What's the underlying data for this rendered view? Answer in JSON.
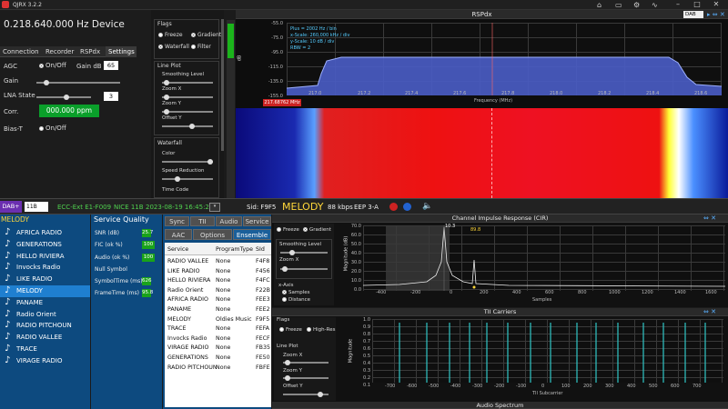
{
  "app": {
    "title": "QJRX 3.2.2",
    "window_controls": [
      "minimize-icon",
      "maximize-icon",
      "close-icon"
    ]
  },
  "frequency": {
    "display": "0.218.640.000 Hz Device"
  },
  "device_tabs": [
    "Connection",
    "Recorder",
    "RSPdx",
    "Settings"
  ],
  "device_settings": {
    "agc_label": "AGC",
    "agc_checkbox_label": "On/Off",
    "gain_db_label": "Gain dB",
    "gain_db_value": "65",
    "gain_label": "Gain",
    "lna_label": "LNA State",
    "lna_value": "3",
    "corr_label": "Corr.",
    "corr_value": "000.000 ppm",
    "biast_label": "Bias-T",
    "biast_radio_label": "On/Off"
  },
  "spectrum_settings": {
    "flags_title": "Flags",
    "freeze": "Freeze",
    "gradient": "Gradient",
    "waterfall": "Waterfall",
    "filter": "Filter",
    "line_plot_title": "Line Plot",
    "smoothing": "Smoothing Level",
    "zoom_x": "Zoom X",
    "zoom_y": "Zoom Y",
    "offset_y": "Offset Y",
    "waterfall_title": "Waterfall",
    "color": "Color",
    "speed": "Speed Reduction",
    "time_code": "Time Code"
  },
  "rspdx": {
    "title": "RSPdx",
    "mode": "DAB",
    "info_lines": [
      "Plus = 2002 Hz / bin",
      "x-Scale: 260,000 kHz / div",
      "y-Scale: 10 dB / div",
      "RBW = 2"
    ],
    "ylabel": "dB",
    "y_ticks": [
      "-55.0",
      "-75.0",
      "-95.0",
      "-115.0",
      "-135.0",
      "-155.0"
    ],
    "x_ticks": [
      "217.0",
      "217.2",
      "217.4",
      "217.6",
      "217.8",
      "218.0",
      "218.2",
      "218.4",
      "218.6"
    ],
    "xlabel": "Frequency (MHz)",
    "marker": "217.68762 MHz"
  },
  "status_bar": {
    "mode": "DAB+",
    "channel": "11B",
    "ensemble_info": "ECC-Ext E1-F009",
    "channel_name": "NICE 11B",
    "datetime": "2023-08-19  16:45:28",
    "sid": "Sid: F9F5",
    "current_service": "MELODY",
    "bitrate": "88 kbps",
    "protection": "EEP 3-A"
  },
  "service_list": {
    "header": "MELODY",
    "items": [
      "AFRICA RADIO",
      "GENERATIONS",
      "HELLO RIVIERA",
      "Invocks Radio",
      "LIKE RADIO",
      "MELODY",
      "PANAME",
      "Radio Orient",
      "RADIO PITCHOUN",
      "RADIO VALLEE",
      "TRACE",
      "VIRAGE RADIO"
    ],
    "selected_index": 5
  },
  "service_quality": {
    "title": "Service Quality",
    "rows": [
      {
        "label": "SNR (dB)",
        "value": "25.7",
        "fraction": 0.4
      },
      {
        "label": "FIC (ok %)",
        "value": "100",
        "fraction": 1.0
      },
      {
        "label": "Audio (ok %)",
        "value": "100",
        "fraction": 1.0
      },
      {
        "label": "Null Symbol",
        "value": "",
        "fraction": 0
      },
      {
        "label": "SymbolTime (ms)",
        "value": "626",
        "fraction": 0.3
      },
      {
        "label": "FrameTime (ms)",
        "value": "95.8",
        "fraction": 0.25
      }
    ]
  },
  "ensemble": {
    "tabs_row1": [
      "Sync",
      "TII",
      "Audio",
      "Service"
    ],
    "tabs_row2": [
      "AAC",
      "Options",
      "Ensemble"
    ],
    "columns": [
      "Service",
      "ProgramType",
      "SId"
    ],
    "rows": [
      [
        "RADIO VALLEE",
        "None",
        "F4F8"
      ],
      [
        "LIKE RADIO",
        "None",
        "F456"
      ],
      [
        "HELLO RIVIERA",
        "None",
        "F4FC"
      ],
      [
        "Radio Orient",
        "None",
        "F22B"
      ],
      [
        "AFRICA RADIO",
        "None",
        "FEE3"
      ],
      [
        "PANAME",
        "None",
        "FEE2"
      ],
      [
        "MELODY",
        "Oldies Music",
        "F9F5"
      ],
      [
        "TRACE",
        "None",
        "FEFA"
      ],
      [
        "Invocks Radio",
        "None",
        "FECF"
      ],
      [
        "VIRAGE RADIO",
        "None",
        "FB35"
      ],
      [
        "GENERATIONS",
        "None",
        "FE50"
      ],
      [
        "RADIO PITCHOUN",
        "None",
        "FBFE"
      ]
    ]
  },
  "cir": {
    "title": "Channel Impulse Response (CIR)",
    "freeze": "Freeze",
    "gradient": "Gradient",
    "smoothing": "Smoothing Level",
    "zoom_x": "Zoom X",
    "xaxis_title": "x-Axis",
    "samples": "Samples",
    "distance": "Distance",
    "ylabel": "Magnitude (dB)",
    "y_ticks": [
      "70.0",
      "60.0",
      "50.0",
      "40.0",
      "30.0",
      "20.0",
      "10.0",
      "0.0"
    ],
    "x_ticks": [
      "-400",
      "-200",
      "0",
      "200",
      "400",
      "600",
      "800",
      "1000",
      "1200",
      "1400",
      "1600"
    ],
    "xlabel": "Samples",
    "peak_label": "10.3",
    "marker_label": "89.8"
  },
  "tii": {
    "title": "TII Carriers",
    "flags": "Flags",
    "freeze": "Freeze",
    "high_res": "High-Res",
    "line_plot": "Line Plot",
    "zoom_x": "Zoom X",
    "zoom_y": "Zoom Y",
    "offset_y": "Offset Y",
    "ylabel": "Magnitude",
    "y_ticks": [
      "1.0",
      "0.9",
      "0.8",
      "0.7",
      "0.6",
      "0.5",
      "0.4",
      "0.3",
      "0.2",
      "0.1"
    ],
    "x_ticks": [
      "-700",
      "-600",
      "-500",
      "-400",
      "-300",
      "-200",
      "-100",
      "0",
      "100",
      "200",
      "300",
      "400",
      "500",
      "600",
      "700"
    ],
    "xlabel": "TII Subcarrier"
  },
  "audio_spectrum": {
    "title": "Audio Spectrum"
  }
}
